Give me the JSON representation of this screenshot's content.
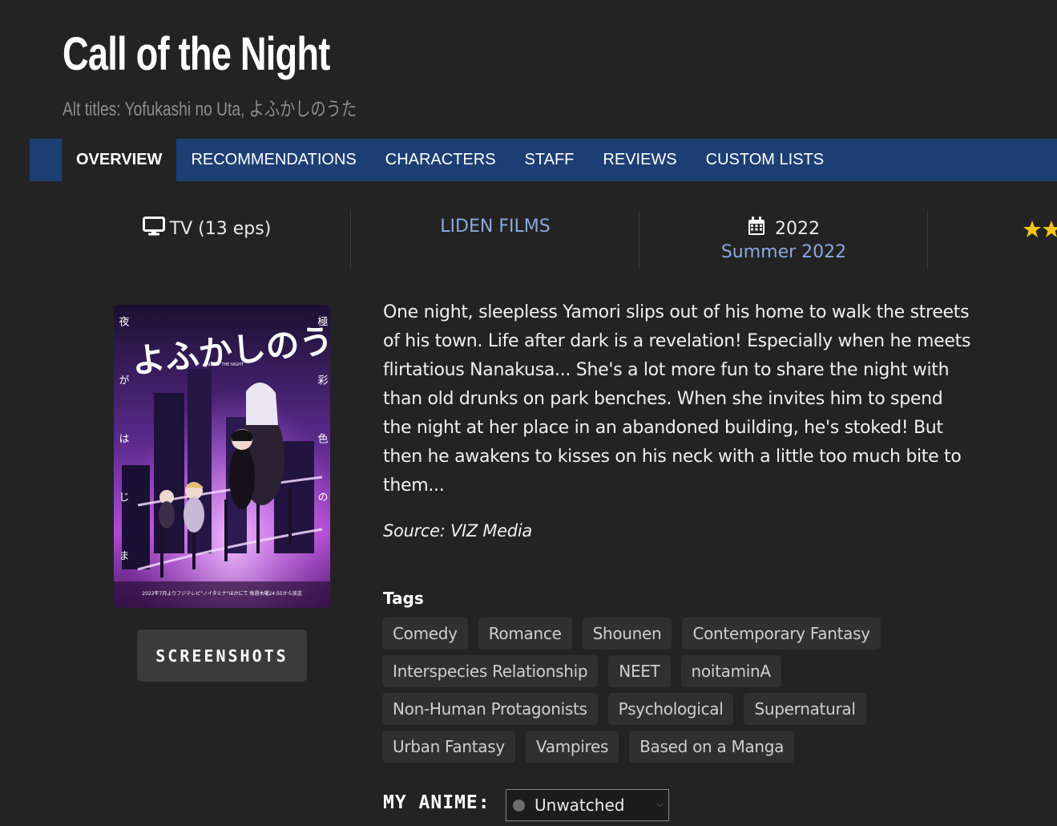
{
  "header": {
    "title": "Call of the Night",
    "alt_label": "Alt titles:",
    "alt_titles": "Yofukashi no Uta, よふかしのうた"
  },
  "tabs": [
    {
      "label": "OVERVIEW",
      "active": true
    },
    {
      "label": "RECOMMENDATIONS"
    },
    {
      "label": "CHARACTERS"
    },
    {
      "label": "STAFF"
    },
    {
      "label": "REVIEWS"
    },
    {
      "label": "CUSTOM LISTS"
    }
  ],
  "info": {
    "format": "TV (13 eps)",
    "format_icon": "monitor-icon",
    "studio": "LIDEN FILMS",
    "year": "2022",
    "year_icon": "calendar-icon",
    "season": "Summer 2022",
    "rating_icon": "star-icon"
  },
  "poster": {
    "title_jp": "よふかしのうた",
    "caption_en": "CALL OF THE NIGHT",
    "side_left": "夜がはじまる",
    "side_right": "極彩色の",
    "bottom_text": "2022年7月よりフジテレビ\"ノイタミナ\"ほかにて 毎週木曜24:55から放送"
  },
  "screenshots_label": "SCREENSHOTS",
  "synopsis": "One night, sleepless Yamori slips out of his home to walk the streets of his town. Life after dark is a revelation! Especially when he meets flirtatious Nanakusa... She's a lot more fun to share the night with than old drunks on park benches. When she invites him to spend the night at her place in an abandoned building, he's stoked! But then he awakens to kisses on his neck with a little too much bite to them...",
  "source": "Source: VIZ Media",
  "tags_heading": "Tags",
  "tags": [
    "Comedy",
    "Romance",
    "Shounen",
    "Contemporary Fantasy",
    "Interspecies Relationship",
    "NEET",
    "noitaminA",
    "Non-Human Protagonists",
    "Psychological",
    "Supernatural",
    "Urban Fantasy",
    "Vampires",
    "Based on a Manga"
  ],
  "my_anime": {
    "label": "MY ANIME:",
    "status": "Unwatched"
  },
  "colors": {
    "background": "#232323",
    "tab_bar": "#1d3f74",
    "link": "#8aa9e0",
    "tag_bg": "#303030",
    "star": "#f5c518"
  }
}
